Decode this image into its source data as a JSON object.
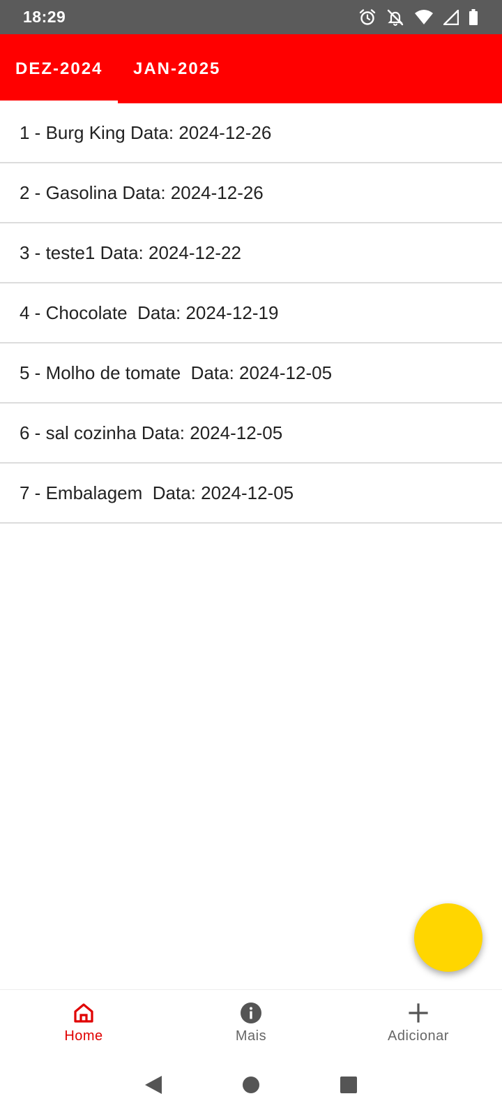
{
  "status_bar": {
    "time": "18:29",
    "icons": [
      "alarm-icon",
      "notifications-off-icon",
      "wifi-icon",
      "signal-icon",
      "battery-icon"
    ]
  },
  "tabs": [
    {
      "label": "DEZ-2024",
      "selected": true
    },
    {
      "label": "JAN-2025",
      "selected": false
    }
  ],
  "items": [
    "1 - Burg King Data: 2024-12-26",
    "2 - Gasolina Data: 2024-12-26",
    "3 - teste1 Data: 2024-12-22",
    "4 - Chocolate  Data: 2024-12-19",
    "5 - Molho de tomate  Data: 2024-12-05",
    "6 - sal cozinha Data: 2024-12-05",
    "7 - Embalagem  Data: 2024-12-05"
  ],
  "bottom_nav": [
    {
      "label": "Home",
      "icon": "home-icon",
      "active": true
    },
    {
      "label": "Mais",
      "icon": "info-icon",
      "active": false
    },
    {
      "label": "Adicionar",
      "icon": "add-icon",
      "active": false
    }
  ],
  "colors": {
    "status_bar": "#5b5b5b",
    "tab_bar": "#ff0000",
    "fab": "#ffd600",
    "active_nav": "#e00000",
    "inactive_nav": "#666666"
  }
}
